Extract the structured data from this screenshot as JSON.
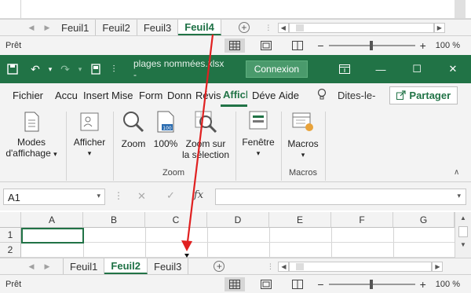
{
  "top_window": {
    "tabs": [
      "Feuil1",
      "Feuil2",
      "Feuil3",
      "Feuil4"
    ],
    "active_tab": "Feuil4",
    "status_text": "Prêt",
    "zoom": "100 %"
  },
  "titlebar": {
    "filename": "plages nommées.xlsx -",
    "connexion_label": "Connexion",
    "accent": "#217346"
  },
  "menu": {
    "items": [
      "Fichier",
      "Accu",
      "Insert",
      "Mise",
      "Form",
      "Donn",
      "Révis",
      "Affich",
      "Déve",
      "Aide"
    ],
    "active": "Affich",
    "tell_me": "Dites-le-",
    "share_label": "Partager"
  },
  "ribbon": {
    "modes_label_1": "Modes",
    "modes_label_2": "d'affichage",
    "afficher_label": "Afficher",
    "zoom_label": "Zoom",
    "zoom100_label": "100%",
    "zoomsel_label_1": "Zoom sur",
    "zoomsel_label_2": "la sélection",
    "group_zoom": "Zoom",
    "fenetre_label": "Fenêtre",
    "macros_label": "Macros",
    "group_macros": "Macros"
  },
  "formula_bar": {
    "namebox_value": "A1",
    "fx": "fx"
  },
  "sheet": {
    "columns": [
      "A",
      "B",
      "C",
      "D",
      "E",
      "F",
      "G"
    ],
    "rows": [
      "1",
      "2"
    ]
  },
  "bottom_window": {
    "tabs": [
      "Feuil1",
      "Feuil2",
      "Feuil3"
    ],
    "active_tab": "Feuil2",
    "status_text": "Prêt",
    "zoom": "100 %"
  },
  "annotation_arrow_color": "#e02020"
}
